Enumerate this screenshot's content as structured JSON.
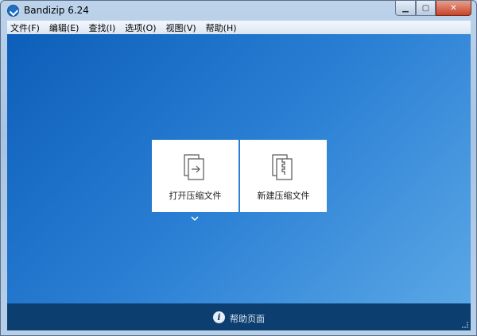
{
  "window": {
    "title": "Bandizip 6.24",
    "minimize": "▭",
    "maximize": "▢",
    "close": "✕"
  },
  "menu": [
    "文件(F)",
    "编辑(E)",
    "查找(I)",
    "选项(O)",
    "视图(V)",
    "帮助(H)"
  ],
  "cards": [
    {
      "label": "打开压缩文件",
      "icon": "open-archive-icon"
    },
    {
      "label": "新建压缩文件",
      "icon": "new-archive-icon"
    }
  ],
  "footer": {
    "help_label": "帮助页面",
    "icon": "info-icon"
  }
}
